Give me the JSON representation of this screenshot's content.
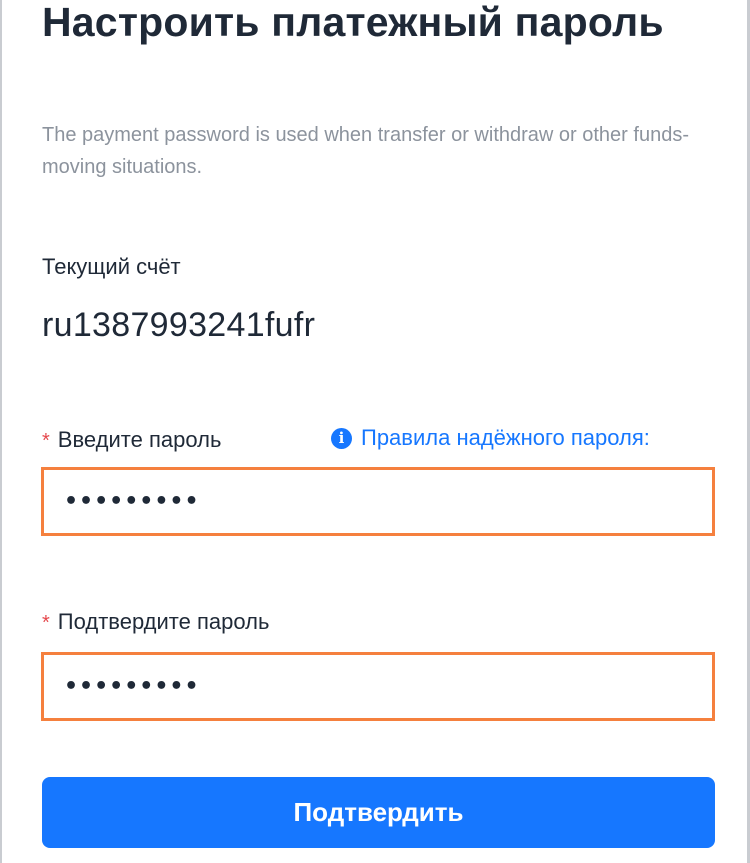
{
  "page": {
    "title": "Настроить платежный пароль",
    "description": "The payment password is used when transfer or withdraw or other funds-moving situations."
  },
  "account": {
    "label": "Текущий счёт",
    "value": "ru1387993241fufr"
  },
  "password_field": {
    "required_marker": "*",
    "label": "Введите пароль",
    "masked_value": "•••••••••"
  },
  "rules_link": {
    "icon": "info-icon",
    "icon_glyph": "i",
    "label": "Правила надёжного пароля:"
  },
  "confirm_field": {
    "required_marker": "*",
    "label": "Подтвердите пароль",
    "masked_value": "•••••••••"
  },
  "submit": {
    "label": "Подтвердить"
  },
  "colors": {
    "accent": "#1677ff",
    "input_border_highlight": "#f5803e",
    "required": "#e5484d",
    "text": "#1f2937",
    "muted_text": "#8c939d"
  }
}
